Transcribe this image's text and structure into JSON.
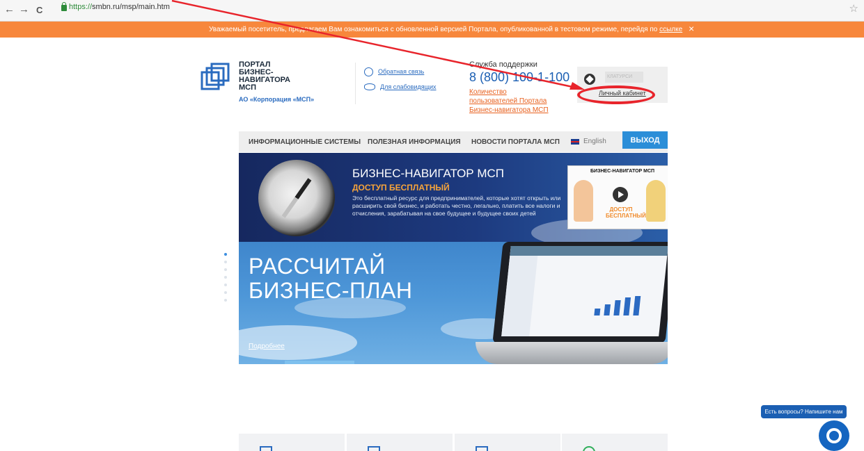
{
  "browser": {
    "back": "←",
    "forward": "→",
    "reload": "C",
    "url_proto": "https://",
    "url_rest": "smbn.ru/msp/main.htm",
    "star": "☆"
  },
  "banner": {
    "text": "Уважаемый посетитель, предлагаем Вам ознакомиться с обновленной версией Портала, опубликованной в тестовом режиме, перейдя по",
    "link": "ссылке",
    "close": "×"
  },
  "header": {
    "logo_lines": [
      "ПОРТАЛ",
      "БИЗНЕС-",
      "НАВИГАТОРА",
      "МСП"
    ],
    "logo_sub": "АО «Корпорация «МСП»",
    "feedback": "Обратная связь",
    "impaired": "Для слабовидящих",
    "support_label": "Служба поддержки",
    "support_phone": "8 (800) 100-1-100",
    "users_link": "Количество пользователей Портала Бизнес-навигатора МСП",
    "cabinet_brand": "КЛАТУРСИ",
    "cabinet_login": "Личный кабинет"
  },
  "menu": {
    "items": [
      "ИНФОРМАЦИОННЫЕ СИСТЕМЫ",
      "ПОЛЕЗНАЯ ИНФОРМАЦИЯ",
      "НОВОСТИ ПОРТАЛА МСП"
    ],
    "english": "English",
    "exit": "ВЫХОД"
  },
  "hero": {
    "title": "БИЗНЕС-НАВИГАТОР МСП",
    "subtitle": "ДОСТУП БЕСПЛАТНЫЙ",
    "description": "Это бесплатный ресурс для предпринимателей, которые хотят открыть или расширить свой бизнес, и работать честно, легально, платить все налоги и отчисления, зарабатывая на свое будущее и будущее своих детей",
    "video_title": "БИЗНЕС-НАВИГАТОР МСП",
    "video_badge": "ДОСТУП БЕСПЛАТНЫЙ"
  },
  "slider": {
    "title_line1": "РАССЧИТАЙ",
    "title_line2": "БИЗНЕС-ПЛАН",
    "more": "Подробнее"
  },
  "chat": {
    "button": "Есть вопросы? Напишите нам"
  },
  "colors": {
    "banner": "#f7873c",
    "accent": "#2b8ed8",
    "annotation": "#e8242b"
  }
}
